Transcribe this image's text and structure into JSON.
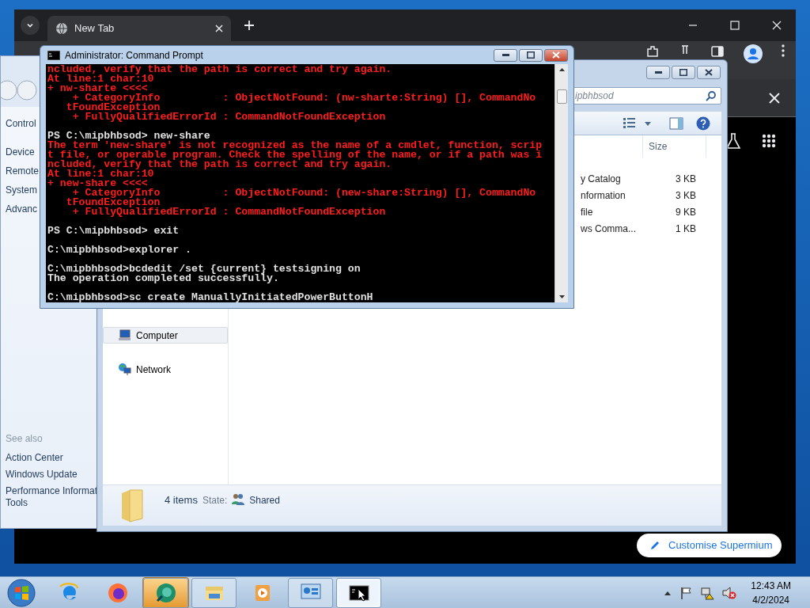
{
  "browser": {
    "tab": {
      "title": "New Tab",
      "selected": true
    },
    "customise_button": "Customise Supermium"
  },
  "control_panel": {
    "nav_links": [
      "Control",
      "Device",
      "Remote",
      "System",
      "Advanc"
    ],
    "see_also": {
      "heading": "See also",
      "links": [
        {
          "lines": [
            "Action Center"
          ]
        },
        {
          "lines": [
            "Windows Update"
          ]
        },
        {
          "lines": [
            "Performance Informat",
            "Tools"
          ]
        }
      ]
    }
  },
  "explorer": {
    "search": {
      "placeholder": "ipbhbsod"
    },
    "columns": [
      "Size"
    ],
    "files": [
      {
        "name": "y Catalog",
        "size": "3 KB"
      },
      {
        "name": "nformation",
        "size": "3 KB"
      },
      {
        "name": "file",
        "size": "9 KB"
      },
      {
        "name": "ws Comma...",
        "size": "1 KB"
      }
    ],
    "nav": [
      {
        "label": "Computer",
        "selected": true,
        "kind": "computer"
      },
      {
        "label": "Network",
        "selected": false,
        "kind": "network"
      }
    ],
    "status": {
      "count": "4 items",
      "state_label": "State:",
      "state": "Shared"
    }
  },
  "cmd": {
    "title": "Administrator: Command Prompt",
    "lines": [
      {
        "text": "ncluded, verify that the path is correct and try again.",
        "kind": "error"
      },
      {
        "text": "At line:1 char:10",
        "kind": "error"
      },
      {
        "text": "+ nw-sharte <<<<",
        "kind": "error"
      },
      {
        "text": "    + CategoryInfo          : ObjectNotFound: (nw-sharte:String) [], CommandNo",
        "kind": "error"
      },
      {
        "text": "   tFoundException",
        "kind": "error"
      },
      {
        "text": "    + FullyQualifiedErrorId : CommandNotFoundException",
        "kind": "error"
      },
      {
        "kind": "blank"
      },
      {
        "text": "PS C:\\mipbhbsod> new-share",
        "kind": "output"
      },
      {
        "text": "The term 'new-share' is not recognized as the name of a cmdlet, function, scrip",
        "kind": "error"
      },
      {
        "text": "t file, or operable program. Check the spelling of the name, or if a path was i",
        "kind": "error"
      },
      {
        "text": "ncluded, verify that the path is correct and try again.",
        "kind": "error"
      },
      {
        "text": "At line:1 char:10",
        "kind": "error"
      },
      {
        "text": "+ new-share <<<<",
        "kind": "error"
      },
      {
        "text": "    + CategoryInfo          : ObjectNotFound: (new-share:String) [], CommandNo",
        "kind": "error"
      },
      {
        "text": "   tFoundException",
        "kind": "error"
      },
      {
        "text": "    + FullyQualifiedErrorId : CommandNotFoundException",
        "kind": "error"
      },
      {
        "kind": "blank"
      },
      {
        "text": "PS C:\\mipbhbsod> exit",
        "kind": "output"
      },
      {
        "kind": "blank"
      },
      {
        "text": "C:\\mipbhbsod>explorer .",
        "kind": "output"
      },
      {
        "kind": "blank"
      },
      {
        "text": "C:\\mipbhbsod>bcdedit /set {current} testsigning on",
        "kind": "output"
      },
      {
        "text": "The operation completed successfully.",
        "kind": "output"
      },
      {
        "kind": "blank"
      },
      {
        "text": "C:\\mipbhbsod>sc create ManuallyInitiatedPowerButtonH",
        "kind": "output"
      }
    ]
  },
  "taskbar": {
    "apps": [
      {
        "kind": "ie",
        "running": false,
        "attention": false,
        "active": false
      },
      {
        "kind": "firefox",
        "running": false,
        "attention": false,
        "active": false
      },
      {
        "kind": "sphere",
        "running": true,
        "attention": true,
        "active": false
      },
      {
        "kind": "folder",
        "running": true,
        "attention": false,
        "active": false
      },
      {
        "kind": "media",
        "running": false,
        "attention": false,
        "active": false
      },
      {
        "kind": "control",
        "running": true,
        "attention": false,
        "active": false
      },
      {
        "kind": "console",
        "running": true,
        "attention": false,
        "active": true
      }
    ],
    "clock": {
      "time": "12:43 AM",
      "date": "4/2/2024"
    }
  }
}
